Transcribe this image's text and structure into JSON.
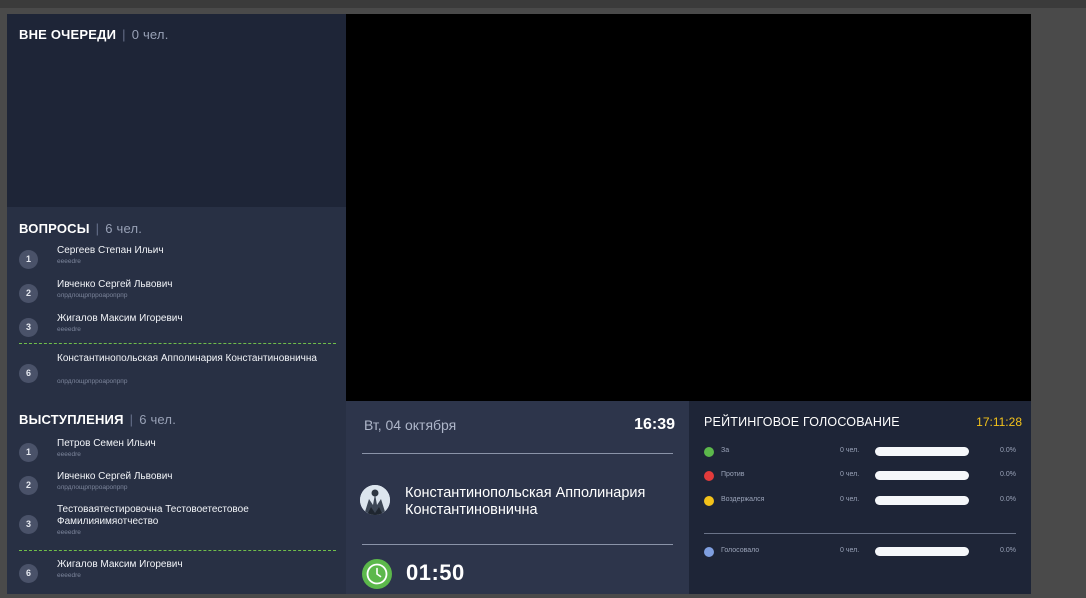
{
  "out_of_queue": {
    "title": "ВНЕ ОЧЕРЕДИ",
    "count": "0 чел."
  },
  "questions": {
    "title": "ВОПРОСЫ",
    "count": "6 чел.",
    "items": [
      {
        "num": "1",
        "name": "Сергеев Степан Ильич",
        "sub": "eeeedre"
      },
      {
        "num": "2",
        "name": "Ивченко Сергей Львович",
        "sub": "олрдлощрпрроаропрпр"
      },
      {
        "num": "3",
        "name": "Жигалов Максим Игоревич",
        "sub": "eeeedre"
      },
      {
        "num": "6",
        "name": "Константинопольская Апполинария Константиновнична",
        "sub": "олрдлощрпрроаропрпр"
      }
    ]
  },
  "speeches": {
    "title": "ВЫСТУПЛЕНИЯ",
    "count": "6 чел.",
    "items": [
      {
        "num": "1",
        "name": "Петров Семен Ильич",
        "sub": "eeeedre"
      },
      {
        "num": "2",
        "name": "Ивченко Сергей Львович",
        "sub": "олрдлощрпрроаропрпр"
      },
      {
        "num": "3",
        "name": "Тестоваятестировочна Тестовоетестовое Фамилияимяотчество",
        "sub": "eeeedre"
      },
      {
        "num": "6",
        "name": "Жигалов Максим Игоревич",
        "sub": "eeeedre"
      }
    ]
  },
  "now": {
    "date": "Вт, 04 октября",
    "time": "16:39",
    "speaker": "Константинопольская Апполинария Константиновнична",
    "avatar_icon": "speaker-photo",
    "clock_icon": "clock-icon",
    "timer": "01:50"
  },
  "vote": {
    "title": "РЕЙТИНГОВОЕ ГОЛОСОВАНИЕ",
    "time": "17:11:28",
    "rows": [
      {
        "label": "За",
        "count": "0 чел.",
        "percent": "0.0%",
        "fraction": 0,
        "color": "#5cb84b"
      },
      {
        "label": "Против",
        "count": "0 чел.",
        "percent": "0.0%",
        "fraction": 0,
        "color": "#e23b3b"
      },
      {
        "label": "Воздержался",
        "count": "0 чел.",
        "percent": "0.0%",
        "fraction": 0,
        "color": "#f3c21a"
      }
    ],
    "total": {
      "label": "Голосовало",
      "count": "0 чел.",
      "percent": "0.0%",
      "fraction": 0,
      "color": "#7f9fe0"
    }
  }
}
